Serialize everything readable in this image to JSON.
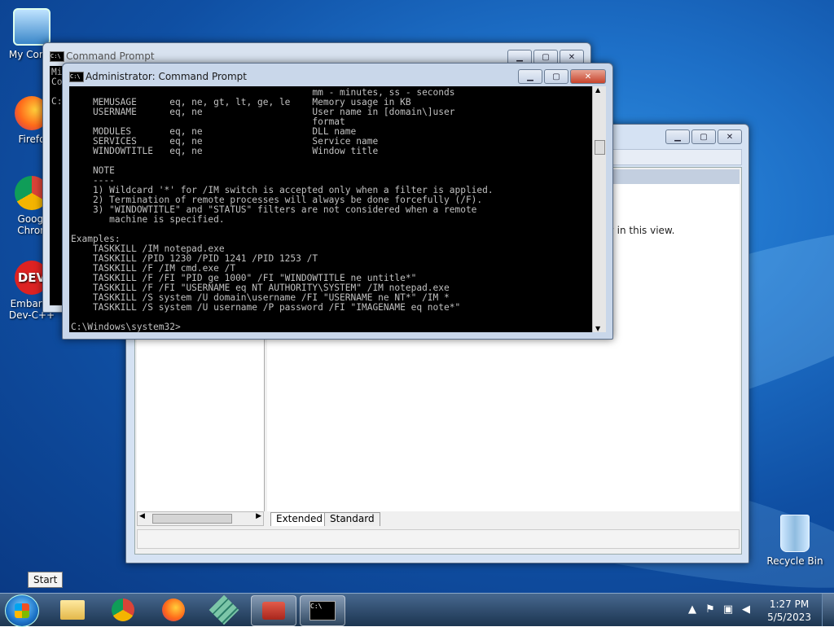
{
  "desktop_icons": [
    {
      "label": "My Comp"
    },
    {
      "label": "Firefo"
    },
    {
      "label": "Googl Chron"
    },
    {
      "label": "Embarca Dev-C++"
    },
    {
      "label": "Recycle Bin"
    }
  ],
  "dev_icon_text": "DEV",
  "back_window": {
    "partial_text": "w in this view.",
    "tabs": [
      "Extended",
      "Standard"
    ]
  },
  "cmd_back": {
    "title": "Command Prompt",
    "partial_lines": "Mi\nCo\n\nC:"
  },
  "cmd_front": {
    "title": "Administrator:  Command Prompt",
    "icon_text": "C:\\",
    "console_text": "                                            mm - minutes, ss - seconds\n    MEMUSAGE      eq, ne, gt, lt, ge, le    Memory usage in KB\n    USERNAME      eq, ne                    User name in [domain\\]user\n                                            format\n    MODULES       eq, ne                    DLL name\n    SERVICES      eq, ne                    Service name\n    WINDOWTITLE   eq, ne                    Window title\n\n    NOTE\n    ----\n    1) Wildcard '*' for /IM switch is accepted only when a filter is applied.\n    2) Termination of remote processes will always be done forcefully (/F).\n    3) \"WINDOWTITLE\" and \"STATUS\" filters are not considered when a remote\n       machine is specified.\n\nExamples:\n    TASKKILL /IM notepad.exe\n    TASKKILL /PID 1230 /PID 1241 /PID 1253 /T\n    TASKKILL /F /IM cmd.exe /T\n    TASKKILL /F /FI \"PID ge 1000\" /FI \"WINDOWTITLE ne untitle*\"\n    TASKKILL /F /FI \"USERNAME eq NT AUTHORITY\\SYSTEM\" /IM notepad.exe\n    TASKKILL /S system /U domain\\username /FI \"USERNAME ne NT*\" /IM *\n    TASKKILL /S system /U username /P password /FI \"IMAGENAME eq note*\"\n\nC:\\Windows\\system32>"
  },
  "tooltip": "Start",
  "taskbar": {
    "items": [
      "windows-explorer",
      "chrome",
      "firefox",
      "app-cube",
      "toolbox",
      "command-prompt"
    ]
  },
  "clock": {
    "time": "1:27 PM",
    "date": "5/5/2023"
  }
}
